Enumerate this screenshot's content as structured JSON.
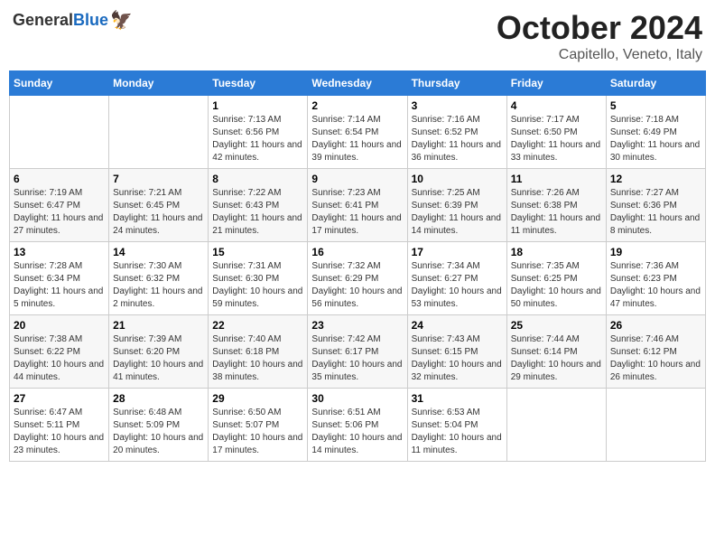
{
  "header": {
    "logo_general": "General",
    "logo_blue": "Blue",
    "month_title": "October 2024",
    "location": "Capitello, Veneto, Italy"
  },
  "weekdays": [
    "Sunday",
    "Monday",
    "Tuesday",
    "Wednesday",
    "Thursday",
    "Friday",
    "Saturday"
  ],
  "weeks": [
    [
      {
        "day": "",
        "info": ""
      },
      {
        "day": "",
        "info": ""
      },
      {
        "day": "1",
        "info": "Sunrise: 7:13 AM\nSunset: 6:56 PM\nDaylight: 11 hours and 42 minutes."
      },
      {
        "day": "2",
        "info": "Sunrise: 7:14 AM\nSunset: 6:54 PM\nDaylight: 11 hours and 39 minutes."
      },
      {
        "day": "3",
        "info": "Sunrise: 7:16 AM\nSunset: 6:52 PM\nDaylight: 11 hours and 36 minutes."
      },
      {
        "day": "4",
        "info": "Sunrise: 7:17 AM\nSunset: 6:50 PM\nDaylight: 11 hours and 33 minutes."
      },
      {
        "day": "5",
        "info": "Sunrise: 7:18 AM\nSunset: 6:49 PM\nDaylight: 11 hours and 30 minutes."
      }
    ],
    [
      {
        "day": "6",
        "info": "Sunrise: 7:19 AM\nSunset: 6:47 PM\nDaylight: 11 hours and 27 minutes."
      },
      {
        "day": "7",
        "info": "Sunrise: 7:21 AM\nSunset: 6:45 PM\nDaylight: 11 hours and 24 minutes."
      },
      {
        "day": "8",
        "info": "Sunrise: 7:22 AM\nSunset: 6:43 PM\nDaylight: 11 hours and 21 minutes."
      },
      {
        "day": "9",
        "info": "Sunrise: 7:23 AM\nSunset: 6:41 PM\nDaylight: 11 hours and 17 minutes."
      },
      {
        "day": "10",
        "info": "Sunrise: 7:25 AM\nSunset: 6:39 PM\nDaylight: 11 hours and 14 minutes."
      },
      {
        "day": "11",
        "info": "Sunrise: 7:26 AM\nSunset: 6:38 PM\nDaylight: 11 hours and 11 minutes."
      },
      {
        "day": "12",
        "info": "Sunrise: 7:27 AM\nSunset: 6:36 PM\nDaylight: 11 hours and 8 minutes."
      }
    ],
    [
      {
        "day": "13",
        "info": "Sunrise: 7:28 AM\nSunset: 6:34 PM\nDaylight: 11 hours and 5 minutes."
      },
      {
        "day": "14",
        "info": "Sunrise: 7:30 AM\nSunset: 6:32 PM\nDaylight: 11 hours and 2 minutes."
      },
      {
        "day": "15",
        "info": "Sunrise: 7:31 AM\nSunset: 6:30 PM\nDaylight: 10 hours and 59 minutes."
      },
      {
        "day": "16",
        "info": "Sunrise: 7:32 AM\nSunset: 6:29 PM\nDaylight: 10 hours and 56 minutes."
      },
      {
        "day": "17",
        "info": "Sunrise: 7:34 AM\nSunset: 6:27 PM\nDaylight: 10 hours and 53 minutes."
      },
      {
        "day": "18",
        "info": "Sunrise: 7:35 AM\nSunset: 6:25 PM\nDaylight: 10 hours and 50 minutes."
      },
      {
        "day": "19",
        "info": "Sunrise: 7:36 AM\nSunset: 6:23 PM\nDaylight: 10 hours and 47 minutes."
      }
    ],
    [
      {
        "day": "20",
        "info": "Sunrise: 7:38 AM\nSunset: 6:22 PM\nDaylight: 10 hours and 44 minutes."
      },
      {
        "day": "21",
        "info": "Sunrise: 7:39 AM\nSunset: 6:20 PM\nDaylight: 10 hours and 41 minutes."
      },
      {
        "day": "22",
        "info": "Sunrise: 7:40 AM\nSunset: 6:18 PM\nDaylight: 10 hours and 38 minutes."
      },
      {
        "day": "23",
        "info": "Sunrise: 7:42 AM\nSunset: 6:17 PM\nDaylight: 10 hours and 35 minutes."
      },
      {
        "day": "24",
        "info": "Sunrise: 7:43 AM\nSunset: 6:15 PM\nDaylight: 10 hours and 32 minutes."
      },
      {
        "day": "25",
        "info": "Sunrise: 7:44 AM\nSunset: 6:14 PM\nDaylight: 10 hours and 29 minutes."
      },
      {
        "day": "26",
        "info": "Sunrise: 7:46 AM\nSunset: 6:12 PM\nDaylight: 10 hours and 26 minutes."
      }
    ],
    [
      {
        "day": "27",
        "info": "Sunrise: 6:47 AM\nSunset: 5:11 PM\nDaylight: 10 hours and 23 minutes."
      },
      {
        "day": "28",
        "info": "Sunrise: 6:48 AM\nSunset: 5:09 PM\nDaylight: 10 hours and 20 minutes."
      },
      {
        "day": "29",
        "info": "Sunrise: 6:50 AM\nSunset: 5:07 PM\nDaylight: 10 hours and 17 minutes."
      },
      {
        "day": "30",
        "info": "Sunrise: 6:51 AM\nSunset: 5:06 PM\nDaylight: 10 hours and 14 minutes."
      },
      {
        "day": "31",
        "info": "Sunrise: 6:53 AM\nSunset: 5:04 PM\nDaylight: 10 hours and 11 minutes."
      },
      {
        "day": "",
        "info": ""
      },
      {
        "day": "",
        "info": ""
      }
    ]
  ]
}
